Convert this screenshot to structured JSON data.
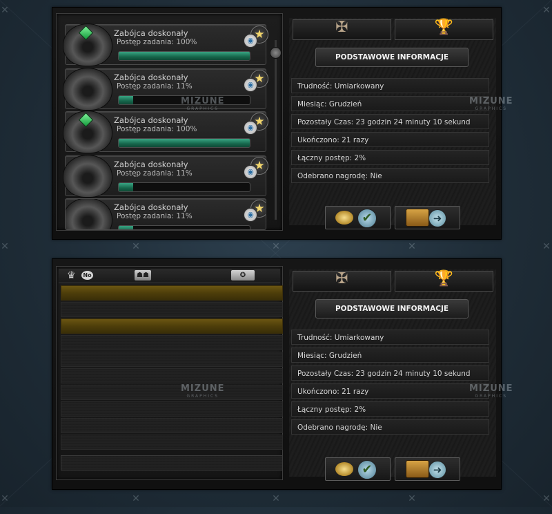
{
  "watermark": {
    "brand": "MIZUNE",
    "sub": "GRAPHICS"
  },
  "colors": {
    "progress_green": "#16664b",
    "gold_row": "#6b5612",
    "text": "#d6d6d6"
  },
  "top_panel": {
    "quests": [
      {
        "title": "Zabójca doskonały",
        "progress_label": "Postęp zadania: 100%",
        "progress": 1.0,
        "completed": true
      },
      {
        "title": "Zabójca doskonały",
        "progress_label": "Postęp zadania: 11%",
        "progress": 0.11,
        "completed": false
      },
      {
        "title": "Zabójca doskonały",
        "progress_label": "Postęp zadania: 100%",
        "progress": 1.0,
        "completed": true
      },
      {
        "title": "Zabójca doskonały",
        "progress_label": "Postęp zadania: 11%",
        "progress": 0.11,
        "completed": false
      },
      {
        "title": "Zabójca doskonały",
        "progress_label": "Postęp zadania: 11%",
        "progress": 0.11,
        "completed": false
      }
    ],
    "info": {
      "header": "PODSTAWOWE INFORMACJE",
      "rows": [
        "Trudność: Umiarkowany",
        "Miesiąc: Grudzień",
        "Pozostały Czas: 23 godzin 24 minuty 10 sekund",
        "Ukończono: 21 razy",
        "Łączny postęp: 2%",
        "Odebrano nagrodę: Nie"
      ]
    }
  },
  "bottom_panel": {
    "ranking_header": {
      "no_badge": "No"
    },
    "info": {
      "header": "PODSTAWOWE INFORMACJE",
      "rows": [
        "Trudność: Umiarkowany",
        "Miesiąc: Grudzień",
        "Pozostały Czas: 23 godzin 24 minuty 10 sekund",
        "Ukończono: 21 razy",
        "Łączny postęp: 2%",
        "Odebrano nagrodę: Nie"
      ]
    }
  },
  "icons": {
    "star": "★",
    "eye": "◉",
    "check": "✔",
    "arrow": "➜",
    "crown": "♛",
    "players": "☗☗",
    "medal": "✪",
    "scroll": "≡",
    "tab1_emblem": "✠",
    "tab2_emblem": "🏆"
  }
}
